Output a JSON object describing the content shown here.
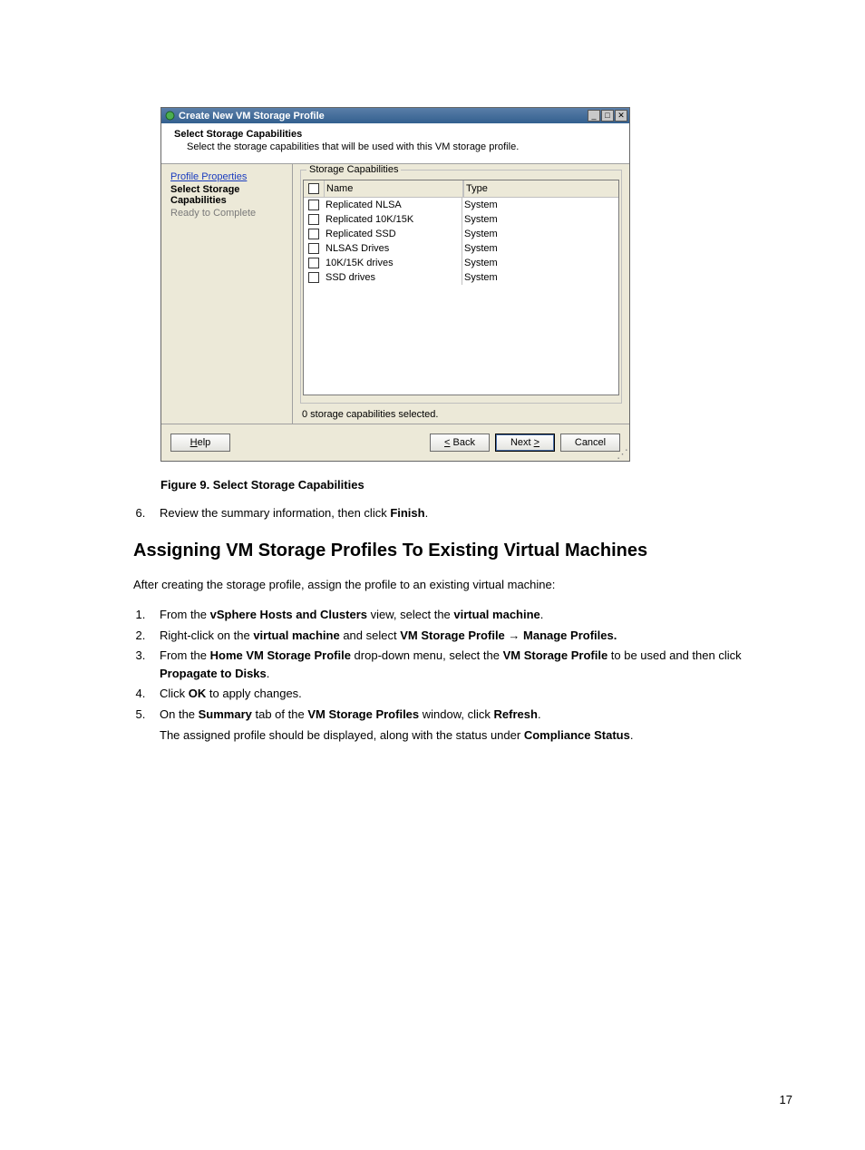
{
  "dialog": {
    "title": "Create New VM Storage Profile",
    "header_title": "Select Storage Capabilities",
    "header_sub": "Select the storage capabilities that will be used with this VM storage profile.",
    "nav": {
      "profile_properties": "Profile Properties",
      "select_storage_capabilities": "Select Storage Capabilities",
      "ready_to_complete": "Ready to Complete"
    },
    "groupbox_legend": "Storage Capabilities",
    "columns": {
      "name": "Name",
      "type": "Type"
    },
    "rows": [
      {
        "name": "Replicated NLSA",
        "type": "System"
      },
      {
        "name": "Replicated 10K/15K",
        "type": "System"
      },
      {
        "name": "Replicated SSD",
        "type": "System"
      },
      {
        "name": "NLSAS Drives",
        "type": "System"
      },
      {
        "name": "10K/15K drives",
        "type": "System"
      },
      {
        "name": "SSD drives",
        "type": "System"
      }
    ],
    "selected_status": "0 storage capabilities selected.",
    "buttons": {
      "help": "Help",
      "back": "Back",
      "next": "Next",
      "cancel": "Cancel"
    },
    "back_accel_prefix": "<",
    "next_accel_suffix": ">"
  },
  "fig_caption": "Figure 9. Select Storage Capabilities",
  "step6_pre": "Review the summary information, then click ",
  "step6_bold": "Finish",
  "step6_post": ".",
  "heading2": "Assigning VM Storage Profiles To Existing Virtual Machines",
  "intro_para": "After creating the storage profile, assign the profile to an existing virtual machine:",
  "steps2": [
    {
      "parts": [
        {
          "t": "From the "
        },
        {
          "b": "vSphere Hosts and Clusters"
        },
        {
          "t": " view, select the "
        },
        {
          "b": "virtual machine"
        },
        {
          "t": "."
        }
      ]
    },
    {
      "parts": [
        {
          "t": "Right-click on the "
        },
        {
          "b": "virtual machine"
        },
        {
          "t": " and select "
        },
        {
          "b": "VM Storage Profile → Manage Profiles."
        }
      ]
    },
    {
      "parts": [
        {
          "t": "From the "
        },
        {
          "b": "Home VM Storage Profile"
        },
        {
          "t": " drop-down menu, select the "
        },
        {
          "b": "VM Storage Profile"
        },
        {
          "t": " to be used and then click "
        },
        {
          "b": "Propagate to Disks"
        },
        {
          "t": "."
        }
      ]
    },
    {
      "parts": [
        {
          "t": "Click "
        },
        {
          "b": "OK"
        },
        {
          "t": " to apply changes."
        }
      ]
    },
    {
      "parts": [
        {
          "t": "On the "
        },
        {
          "b": "Summary"
        },
        {
          "t": " tab of the "
        },
        {
          "b": "VM Storage Profiles"
        },
        {
          "t": " window, click "
        },
        {
          "b": "Refresh"
        },
        {
          "t": "."
        }
      ],
      "trail": "The assigned profile should be displayed, along with the status under ",
      "trail_bold": "Compliance Status",
      "trail_post": "."
    }
  ],
  "pagenum": "17"
}
